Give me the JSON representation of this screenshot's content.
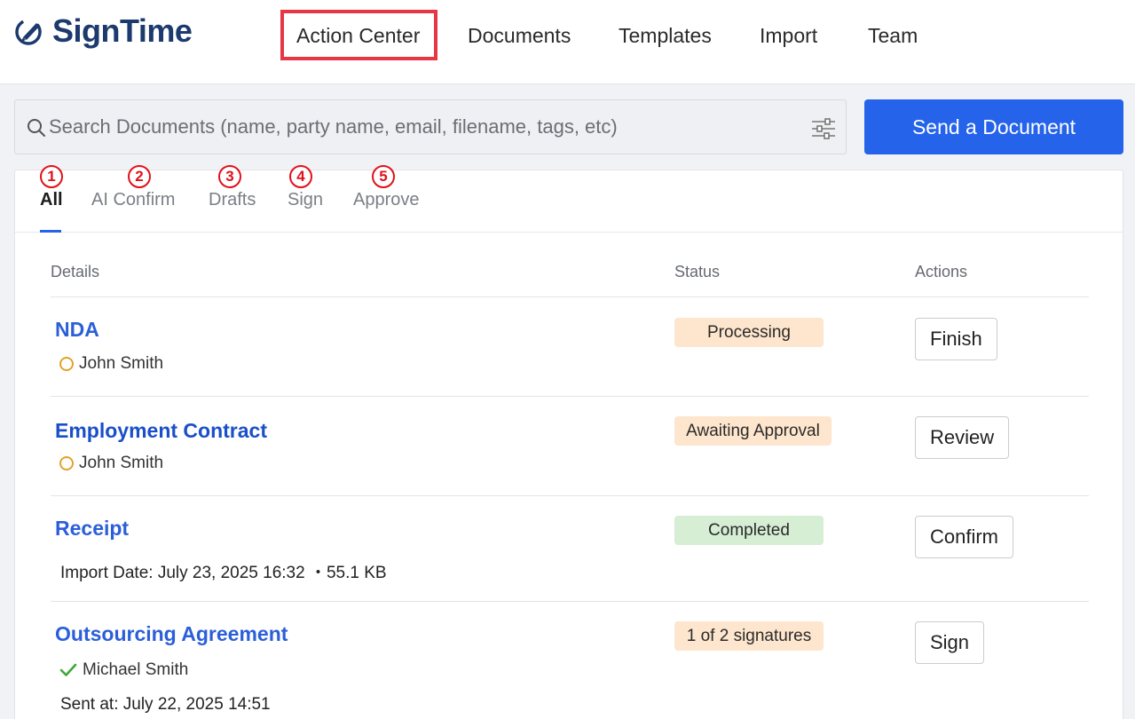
{
  "app": {
    "name": "SignTime"
  },
  "nav": {
    "items": [
      {
        "label": "Action Center"
      },
      {
        "label": "Documents"
      },
      {
        "label": "Templates"
      },
      {
        "label": "Import"
      },
      {
        "label": "Team"
      }
    ]
  },
  "search": {
    "placeholder": "Search Documents (name, party name, email, filename, tags, etc)"
  },
  "send_button": "Send a Document",
  "tabs": [
    {
      "label": "All",
      "num": "1"
    },
    {
      "label": "AI Confirm",
      "num": "2"
    },
    {
      "label": "Drafts",
      "num": "3"
    },
    {
      "label": "Sign",
      "num": "4"
    },
    {
      "label": "Approve",
      "num": "5"
    }
  ],
  "table": {
    "headers": {
      "details": "Details",
      "status": "Status",
      "actions": "Actions"
    },
    "rows": [
      {
        "title": "NDA",
        "party": "John Smith",
        "status": "Processing",
        "action": "Finish"
      },
      {
        "title": "Employment Contract",
        "party": "John Smith",
        "status": "Awaiting Approval",
        "action": "Review"
      },
      {
        "title": "Receipt",
        "meta": "Import Date: July 23, 2025 16:32 ・55.1 KB",
        "status": "Completed",
        "action": "Confirm"
      },
      {
        "title": "Outsourcing Agreement",
        "party": "Michael Smith",
        "meta": "Sent at: July 22, 2025 14:51",
        "status": "1 of 2 signatures",
        "action": "Sign"
      }
    ]
  },
  "colors": {
    "accent": "#2563eb",
    "highlight": "#e53744",
    "pending": "#e3a228",
    "done": "#3fa63a"
  }
}
